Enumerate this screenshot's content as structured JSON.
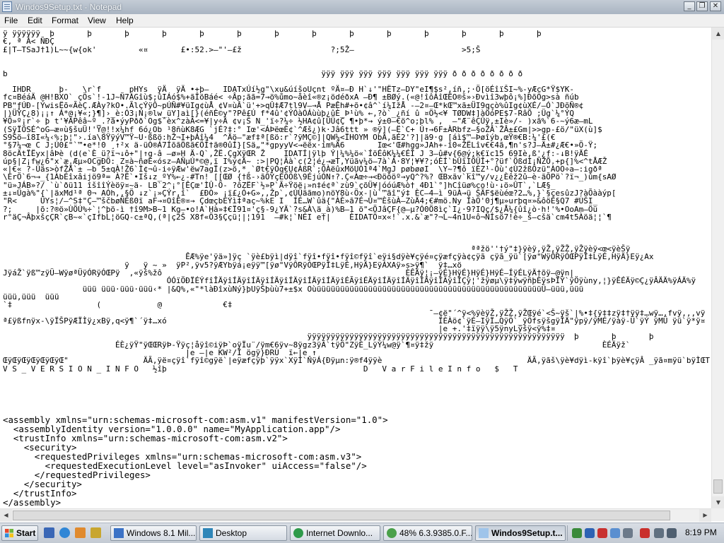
{
  "window": {
    "title": "Windos9Setup.txt - Notepad"
  },
  "menu": [
    "File",
    "Edit",
    "Format",
    "View",
    "Help"
  ],
  "editor": {
    "lines": [
      "ÿ ÿÿÿÿÿÿ  þ       þ       þ       þ       þ       þ       þ       þ       þ       þ       þ       þ       þ       þ",
      "€, ª Á< ÑĐÇ",
      "£|T—TSaJ†1)L~~{w{ok'         «¤       £•:52.>—\"'–£ž                   ?;5Ž–                       >5;Š",
      "",
      "",
      "b                                                                   ÿÿÿ ÿÿÿ ÿÿÿ ÿÿÿ ÿÿÿ ÿÿÿ ÿÿÿ ð ð ð ð ð ð ð ð",
      "",
      "  IHDR      þ-   \\r`f      pHYs  ÿÄ  ÿÄ •+þ–   IDATxÚí½g\"\\xu&úíšoUçnt ºÄ¤–Ð H`↓'\"HËTz–DY\"eI¶$s²,íñ,;·Ö[öÉîïŠI~%-yÆcG*Ÿ$YK-",
      "fc¤BéáÄ @H!BXO` çÖs`!-1J~Ñ7ÁGîù$;ûIÁó$%+ãÎöBáé< ÷Âp;ãã=7→ö%ůmo~åèî«®z¡ödéðxA –Ð¶ ±BØý.(«@!îôÁîŒËO®š»›Ðvìî3wþô¡%]ÐõÖg>sà ñúb",
      "PB\"ƒÚÐ-[ÝwisËõ«ÃèÇ.ÆÀy?kO•.ÃlçÝÿÔ~pÚÑ#¥üIg¢ùÅ ¢V¤ùÂ`ü'+>qÛ‡Æ7tl9V–→Å PæÊh#+õ•¢â^`í¼IžÅ -–2¤—Œ*kŒ™xã±ÜI9qçò%ûIg¢ùXÉ/–Ó`JÐõÑ®¢",
      "|)ÜÝÇ¿8)¡¡↑ Á*@¡¥«;}¶]›_è:Ó3¡N¡®lw_üY]aì[}(éñÈ©y\"?Pê£Ú f*4û'¢ÝÓàÓÁùùþ¿ûÈ_Þ¹ù% ←,?ò`_¿ñí û ¤Ö½<¥ TØDW‡]àÖóPE$7-RâÕ ;Üg`¼°ÝQ",
      "¥Ö»º¡r`÷ þ t'¥ÃPêâ~º_.?ã•ýyPðð`Og$ˆèx^zàÃ<=¥|y÷Â ¢v¡Ŝ N_'ï÷?¼÷ ½HA¢û[ÜÜ¢Ç ¶•þ*→ ý±0–€ö^o;þl% ,  —\"Æ¨êÇÛÿ,±Iè»/- )xã%`6-~ý6æ–mL",
      "(SÿÏÖSÉ^oG–æ¤ù§šuÜ!'Ÿ@!!x¼hf 6ó¿Ob ¹8ñùK8ÆG `jÉ?‡:° Iœ'<ÁÞëœÈ¢`^Æš¿)k·Jâ6ttt » ®ÿ](–Ë`C+ Ú↑→6F±ÀRbfz–§oŽÂ`ŽÂ±£Gm|>>gp-£ö/\"üX(ù]$",
      "S9Šö–î8I«¼‹%;þ¦\"›.ía\\8ŸÿýV™Ÿ~U·ßßö:hŽ¬I+þÁî¼4  ^Äö–\"æf‡ª[ßö:r`?ÿMÇ©]|QW¼<ÏHOYM ObÂ,ãÉ2'?]|ä9·g [áì$™–Þøîýb,œŸ®€B:¼'£(€",
      "°§7¼¬œ C J;Ú0£\"`™•e*!0 ¸↑²x ä-üÒ®Á7ÍõãÖßã€ÖÌ†ã®0ûÍ}[Sä„\"*gpyyV<→ëëx·ím%Ä6       Iœ<'Œ#hgg»JAh+-î0«ŽËLîv€€4ã,¶n's?J–Ä±#¿Æ€•»Ö-Ÿ;",
      "8öcÄtÏËyx|âÞè (d(e`È_ü?ï¬↓ô+\"|↑g-â –ø»H Ä-Q`,ŽË.ÇgXÿŒR Ž    IDATÍ|ÿlþ Ý|¼%¼ö«`ÍöÉôK¼¼€ÉÎ J 3–û#v{6@ý;k€ïc15 69Iè,ß'¿f:-↓B!ÿÄÉ",
      "úp§|Z¡fw¿6\"x`æ.Æµ»OCgÐÖ: Z¤à~ñøÉ«ósz–AÑµÚ*©@,ï I%ý¢Ä~ :>|PQ¦Ãà`c(2¦é¿→æT,Yüãv¼ö–7à`Á·8Y¦¥¥?;óÈÍ`bÛïIÖÜÎ+°?üf`ÖßdÌ¡ÑŽÕ.+p{]%<^tÅÆŽ",
      "«|€« ?-Üäs>òfŽÅ`± –b 5±qÀ!Ž6`Ì¢¬û-i÷ÿÆw'ëw7agÏ(z>ö,*¸`Øt€ÿÓq€U¢ÀßR`;ÒÀëûxMöUÓ1ª4`MgJ pøbøøI  \\Y~?¶ô_ïÈZ¹-Ôù'¢Ù2žßÔzü\"ÀOO÷a–:igðª",
      "\\ErÖ`6¬→_{1ÀbÉîxâijö9ª= À?Ë`•Iš↓z_ºY%←¿-#Tn! [[ŒØ {†ß-›ãÔÝçÈÖÖß\\9ÉjúÓN↑?.Ç«Àœ÷→<Ðöôöº→yQ^?%? ŒBxãv`kî™y/v¿¿Èêž2û–è-ãÕPö`?ï¬_)ûm{sAØ",
      "\"ü»JÁB»?/ `ù`ðü11 îšîîÝèöÿ¤~ä- LB`2^¡°[ÊÇœ'ÌÛ-Ö- ?ôZËF`½»P`Ã÷Ÿöë¡»n‡é¢ª`zù9`çõÜ¥|óóúÆ%ò† 4Ð1`°]hCîüø%co!ù·↓ö»ÛT`,`LÆ§_",
      "±↓¤Ügà%\"{`|äxMd¹ª 0¬ AÓh,,§Ö ↓z`¡»ÇÝr,î`  £ÐÒ» ¡ï£¿Ó+G»,,Žp`,¢ÚÜäãmo)nöY8ù‹Öx-|ù`™ãî\"ý‡ ÈC–4–ì 9üÀ→ü ŠÃF$ëùéœ?2…%,}`§çesûzJ?àÕààýp[",
      "\"R<     ÛYs¦/–^S‡\"Ç–™ščbøÑÉß0ï aF→¤OîÊ®¤→ ÇdœçbÈÝì‡ªaç~%kE I  ÍÉ…W`ûä{\"ÀÈ»ã7É¬U¤™ÈšùÀ–ZùÄ4;€#mö.Ny ÎàÖ'0j¶µ»urþq¤»&ôöÈ§Q7 #ÙŠI_",
      "?;     |õ:?®ö»ÙÖÚ%÷`¦^þö-ì †î9M>B~1 Kg—•o!A`Hà»‡€Ï91¤'ç§-9¿YÄ`?s&À\\ä_à)%B–1 ö\"<ÖJâÇF{@–µ?Ó0Ö8ìç`I¿·9?IQç/$¿Å¼{ûî¿ò·h!'%•OoAm–Öü",
      "r°äÇ¬ÂþxšçÇR`çB~«`çIfbL¦öGQ-c±ªQ,(ª|ç2Š X8f«Ö3§Ççü¦|¦191  –#k¦`NÉI e†|    ÈIDATÖ¤x«!`.x.&`æ\"?¬L~4n1U«ô¬ÑÍsö7!è÷_š–cšä`cm4t5Àöä¦¦`¶",
      "",
      "",
      "",
      "                                                                                                    ªªžö''†ý\"‡}ÿèÿ,ÿŽ,ÿŽŽ,ÿŽÿèÿ<œ<ÿèŠÿ",
      "                                       ÊÆ%ÿe'ÿä»]ÿç `ÿè£bÿì|dÿî`fÿî•fÿî•fÿî©fÿî`eÿi§dÿè¥çÿé¤çÿæfçÿà¢çÿã çÿã_ÿü`[ÿø\"WÿÔRÿÓŒPÿÎ‡LÿÉ,HÿÄ}Eÿ¿Ax",
      "                          ÿ   ÿ ~ »  ÿP²,ÿv5?ÿÆYbÿá¡eÿÿ™[ÿø\"VÿÔRÿÓŒPÿÎ‡LÿÉ,HÿÄ}EÿÁXAÿ»s>ÿ¶`  ÿ‡…xö",
      "JÿáŽ`ÿß™zÿÜ–WÿøªÜÿÓRÿÓŒPÿ  ,«ÿš%žô                                                    ÈÊÄÿ¦¡–ÿÉ}HÿÉ}HÿÉ}HÿÉ–ÍÿÉLÿÄ†õÿ–@ÿn|",
      "                                   ÓÓïÖÐÏÉÝfîÎÄÿîÍÄÿîÍÄÿîÍÄÿîÍÄÿîÍÄÿîÍÄÿîÉÃÿîÉÄÿîÍÄÿîÍÄÿîÍÄÿîÍÃÿîÎÇÿ¦'žÿøµ\\ÿ‡ÿwÿñþÈÿsÞÏÝ`ÿÖÿùny,¦}ÿÊÉÄÿ©Ç¿ÿÂÄÄ%ÿÁÄ%ÿ",
      "                 üüü üüü·üüü·üüü‹* |&Q%,«\"*làÐîxùNý}þUÿŠþùù7+±$x OùüüüüüüüüüüüüüüüüüüüüüüüüüüüüüüüüüüüüüüüüüüüüüüüüÜ–üüü,üüü",
      "üüü,üüü  üüü",
      "`‡                  (            @             €‡",
      "                                                                                           ¯–¢ë\"´^ÿ<%ÿèÿŽ,ÿŽŽ,ÿŽŒÿé`<Š~ÿš`|%•‡{ÿ‡‡zÿ‡†ÿÿ‡…wÿ…,fvÿ,,,vÿ",
      "ª£ÿßfnÿx-\\ÿÏŠPÿÆÏÌÿ¿xBÿ,q<ÿ¶`´ÿ‡…xó                                                          ÏÈÀö¢`ÿÉ–IÿÏ…QÿÖ`_ÿÖfsÿšgÿÎÄ\"ÿpÿ/ÿMÉ/ÿàÿ-Ü`ÿÝ ÿMÜ ÿü`ÿ*ÿ¤",
      "                                                                                             |e +.'‡ïÿÿ\\ÿ5ÿnyLÿšÿ<ÿ%‡¤",
      "                                                                 ÿÿÿÿÿÿÿÿÿÿÿÿÿÿÿÿÿÿÿÿÿÿÿÿÿÿÿÿÿÿÿÿÿÿÿÿÿÿÿÿÿÿÿÿÿÿÿÿÿÿÿÿÿÿÿ  þ       þ       þ",
      "                        ÉÈ¿ÿŸ\"ÿŒŒRÿÞ-Ÿÿç¦åÿî©iÿÞ`oÿÏu¨/ÿm€6ÿv~8ÿgz3ÿÃ`tÿÖ\"ZÿÈ_LÿÝ¼w@ÿ`¶¤ÿ‡žÿ                                    ÈÉÄÿž`",
      "                                       |e –|e KW²/Î ögÿ}ÐRÙ  ï←|e ↑",
      "ŒÿŒÿŒÿŒÿŒÿŒÿŒ\"                ÄÃ,ÿë¤çÿî`fÿî©gÿë`|eÿæfçÿþ`ÿÿx`XÿÍ`ŇÿÁ{Ðÿµn:ÿ®f4ÿÿè                               ÄÃ,ÿãš\\ÿè¥dÿì-kÿî`þÿè¥çÿÂ _ÿã¤mÿü`bÿÌŒT",
      "V S _ V E R S I O N _ I N F O   ½îþ                                          D   V a r F i l e I n f o   $   T"
    ],
    "xml_lines": [
      "<assembly xmlns=\"urn:schemas-microsoft-com:asm.v1\" manifestVersion=\"1.0\">",
      "  <assemblyIdentity version=\"1.0.0.0\" name=\"MyApplication.app\"/>",
      "  <trustInfo xmlns=\"urn:schemas-microsoft-com:asm.v2\">",
      "    <security>",
      "      <requestedPrivileges xmlns=\"urn:schemas-microsoft-com:asm.v3\">",
      "        <requestedExecutionLevel level=\"asInvoker\" uiAccess=\"false\"/>",
      "      </requestedPrivileges>",
      "    </security>",
      "  </trustInfo>",
      "</assembly>"
    ]
  },
  "taskbar": {
    "start_label": "Start",
    "buttons": [
      "Windows 8.1 Mil...",
      "Desktop",
      "Internet Downlo...",
      "48% 6.3.9385.0.F...",
      "Windos9Setup.t..."
    ],
    "clock": "8:19 PM"
  },
  "colors": {
    "titlebar": "#b4bdc9",
    "taskbar": "#cdd3db",
    "editor_bg": "#ffffff"
  }
}
